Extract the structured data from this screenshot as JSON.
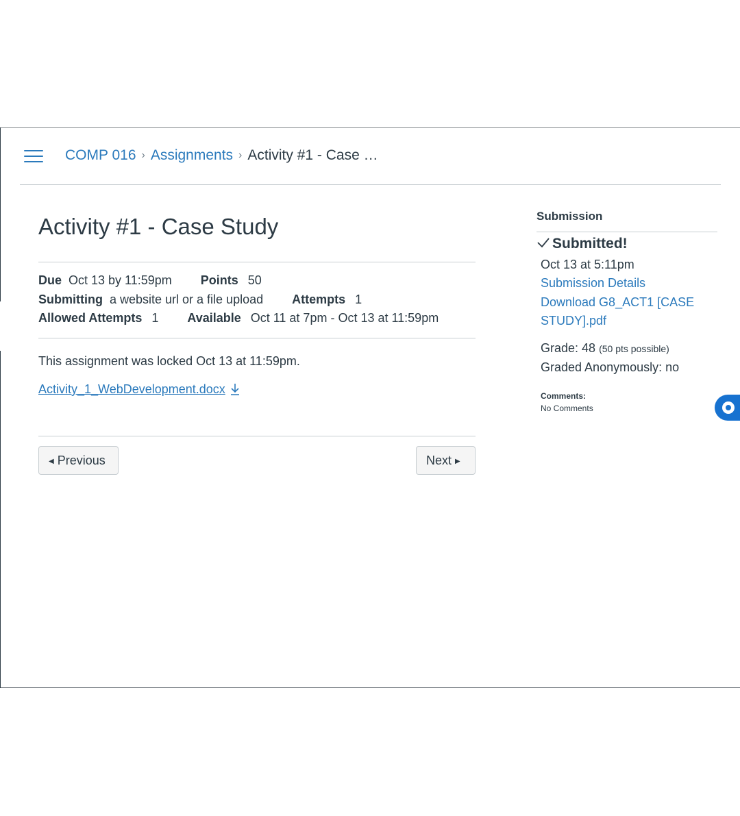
{
  "breadcrumb": {
    "course": "COMP 016",
    "section": "Assignments",
    "current": "Activity #1 - Case …"
  },
  "assignment": {
    "title": "Activity #1 - Case Study",
    "due_label": "Due",
    "due_value": "Oct 13 by 11:59pm",
    "points_label": "Points",
    "points_value": "50",
    "submitting_label": "Submitting",
    "submitting_value": "a website url or a file upload",
    "attempts_label": "Attempts",
    "attempts_value": "1",
    "allowed_label": "Allowed Attempts",
    "allowed_value": "1",
    "available_label": "Available",
    "available_value": "Oct 11 at 7pm - Oct 13 at 11:59pm",
    "locked_text": "This assignment was locked Oct 13 at 11:59pm.",
    "attachment": "Activity_1_WebDevelopment.docx"
  },
  "nav": {
    "previous": "Previous",
    "next": "Next"
  },
  "sidebar": {
    "heading": "Submission",
    "status": "Submitted!",
    "submitted_at": "Oct 13 at 5:11pm",
    "details_link": "Submission Details",
    "download_link_line1": "Download G8_ACT1 [CASE",
    "download_link_line2": "STUDY].pdf",
    "grade_label": "Grade: 48",
    "grade_possible": "(50 pts possible)",
    "anonymous": "Graded Anonymously: no",
    "comments_label": "Comments:",
    "comments_value": "No Comments"
  },
  "colors": {
    "link": "#2b7abc",
    "text": "#2d3b45",
    "accent_button": "#1772d0"
  },
  "icons": [
    "hamburger-menu-icon",
    "chevron-right-icon",
    "download-icon",
    "checkmark-icon",
    "caret-left-icon",
    "caret-right-icon",
    "chat-bubble-icon"
  ]
}
